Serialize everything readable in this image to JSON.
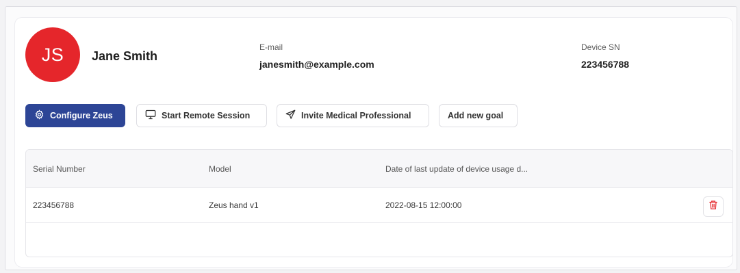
{
  "profile": {
    "initials": "JS",
    "name": "Jane Smith",
    "email_label": "E-mail",
    "email": "janesmith@example.com",
    "device_sn_label": "Device SN",
    "device_sn": "223456788",
    "avatar_color": "#e5262b"
  },
  "actions": {
    "configure": "Configure Zeus",
    "remote_session": "Start Remote Session",
    "invite": "Invite Medical Professional",
    "add_goal": "Add new goal",
    "primary_color": "#2d4596"
  },
  "table": {
    "columns": [
      "Serial Number",
      "Model",
      "Date of last update of device usage d..."
    ],
    "rows": [
      {
        "serial": "223456788",
        "model": "Zeus hand v1",
        "date": "2022-08-15 12:00:00"
      }
    ],
    "delete_icon": "trash-icon",
    "delete_color": "#e5262b"
  }
}
